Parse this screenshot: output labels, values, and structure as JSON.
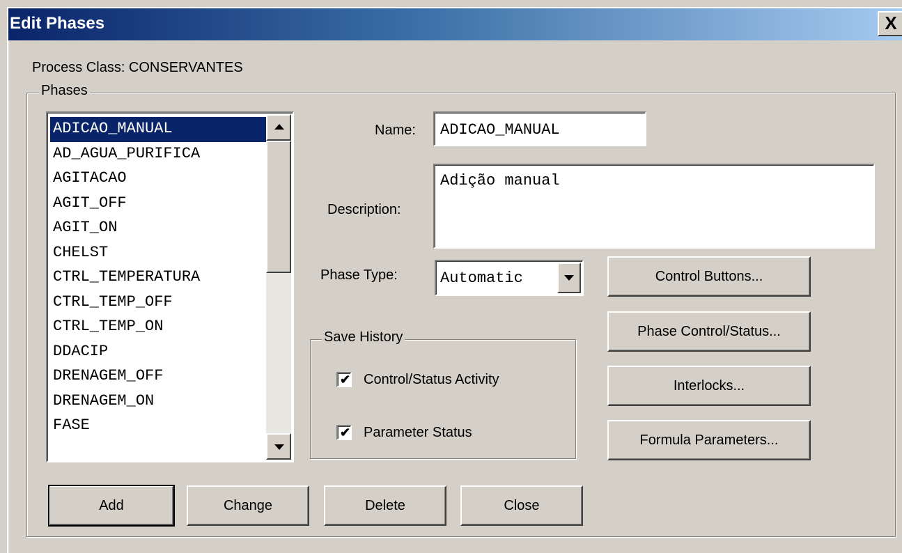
{
  "window": {
    "title": "Edit Phases",
    "close_glyph": "X"
  },
  "process_class": "Process Class: CONSERVANTES",
  "phases_group_label": "Phases",
  "phases_list": [
    "ADICAO_MANUAL",
    "AD_AGUA_PURIFICA",
    "AGITACAO",
    "AGIT_OFF",
    "AGIT_ON",
    "CHELST",
    "CTRL_TEMPERATURA",
    "CTRL_TEMP_OFF",
    "CTRL_TEMP_ON",
    "DDACIP",
    "DRENAGEM_OFF",
    "DRENAGEM_ON",
    "FASE"
  ],
  "selected_phase_index": 0,
  "fields": {
    "name_label": "Name:",
    "name_value": "ADICAO_MANUAL",
    "description_label": "Description:",
    "description_value": "Adição manual",
    "phase_type_label": "Phase Type:",
    "phase_type_value": "Automatic"
  },
  "save_history": {
    "label": "Save History",
    "control_status_activity": {
      "label": "Control/Status Activity",
      "checked": true
    },
    "parameter_status": {
      "label": "Parameter Status",
      "checked": true
    }
  },
  "side_buttons": {
    "control_buttons": "Control Buttons...",
    "phase_control_status": "Phase Control/Status...",
    "interlocks": "Interlocks...",
    "formula_parameters": "Formula Parameters..."
  },
  "bottom_buttons": {
    "add": "Add",
    "change": "Change",
    "delete": "Delete",
    "close": "Close"
  },
  "colors": {
    "title_gradient_start": "#0a246a",
    "title_gradient_end": "#a6caf0",
    "selection": "#0a246a",
    "face": "#d4d0c8"
  }
}
